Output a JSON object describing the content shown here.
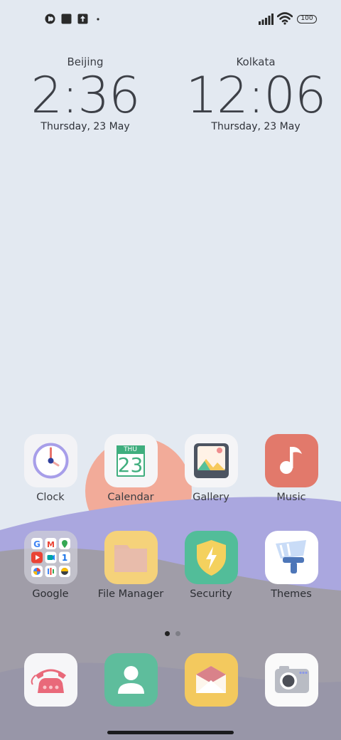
{
  "status_bar": {
    "left_icons": [
      "app-notification-icon",
      "square-notification-icon",
      "upload-notification-icon",
      "more-dot-icon"
    ],
    "battery": "100",
    "right_icons": [
      "signal-icon",
      "wifi-icon",
      "battery-icon"
    ]
  },
  "clocks": [
    {
      "city": "Beijing",
      "time": "2:36",
      "date": "Thursday, 23 May"
    },
    {
      "city": "Kolkata",
      "time": "12:06",
      "date": "Thursday, 23 May"
    }
  ],
  "apps_row1": [
    {
      "label": "Clock",
      "icon": "clock-icon"
    },
    {
      "label": "Calendar",
      "icon": "calendar-icon",
      "icon_text_month": "THU",
      "icon_text_day": "23"
    },
    {
      "label": "Gallery",
      "icon": "gallery-icon"
    },
    {
      "label": "Music",
      "icon": "music-icon"
    }
  ],
  "apps_row2": [
    {
      "label": "Google",
      "icon": "google-folder-icon",
      "folder_letters": [
        "G",
        "M"
      ]
    },
    {
      "label": "File Manager",
      "icon": "folder-icon"
    },
    {
      "label": "Security",
      "icon": "security-shield-icon"
    },
    {
      "label": "Themes",
      "icon": "themes-brush-icon"
    }
  ],
  "page_indicator": {
    "pages": 2,
    "current": 1
  },
  "dock": [
    {
      "icon": "phone-icon"
    },
    {
      "icon": "contacts-icon"
    },
    {
      "icon": "messages-icon"
    },
    {
      "icon": "camera-icon"
    }
  ],
  "colors": {
    "background": "#e3e9f1",
    "sun": "#f2ab99",
    "hill_purple": "#aba8de",
    "hill_gray": "#9e9ca6",
    "hill_dark": "#8f8d99"
  }
}
